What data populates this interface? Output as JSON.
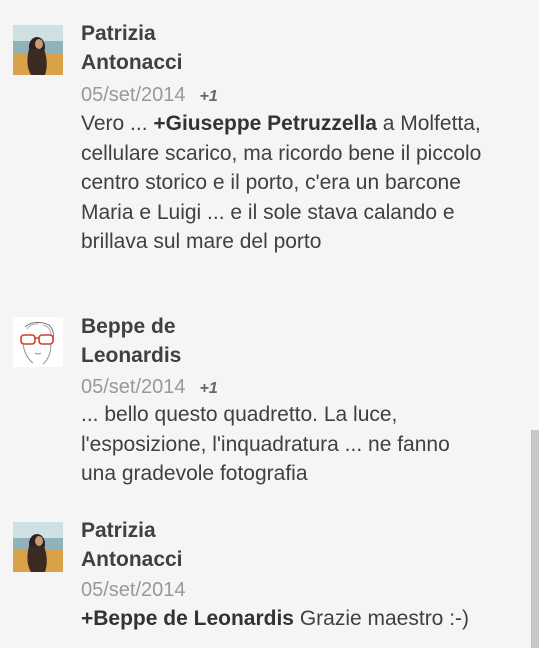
{
  "comments": [
    {
      "author_line1": "Patrizia",
      "author_line2": "Antonacci",
      "date": "05/set/2014",
      "plus": "+1",
      "mention": "+Giuseppe Petruzzella",
      "text_after": " a Molfetta, cellulare scarico, ma ricordo bene il piccolo centro storico e il porto, c'era un barcone Maria e Luigi ... e il sole stava calando e brillava sul mare del porto",
      "text_before": "Vero ... "
    },
    {
      "author_line1": "Beppe de",
      "author_line2": "Leonardis",
      "date": "05/set/2014",
      "plus": "+1",
      "text": "... bello questo quadretto. La luce, l'esposizione, l'inquadratura ... ne fanno una gradevole fotografia"
    },
    {
      "author_line1": "Patrizia",
      "author_line2": "Antonacci",
      "date": "05/set/2014",
      "mention": "+Beppe de Leonardis",
      "text_after": " Grazie maestro :-)"
    }
  ],
  "colors": {
    "background": "#f5f5f5",
    "text": "#404040",
    "meta": "#999999"
  }
}
